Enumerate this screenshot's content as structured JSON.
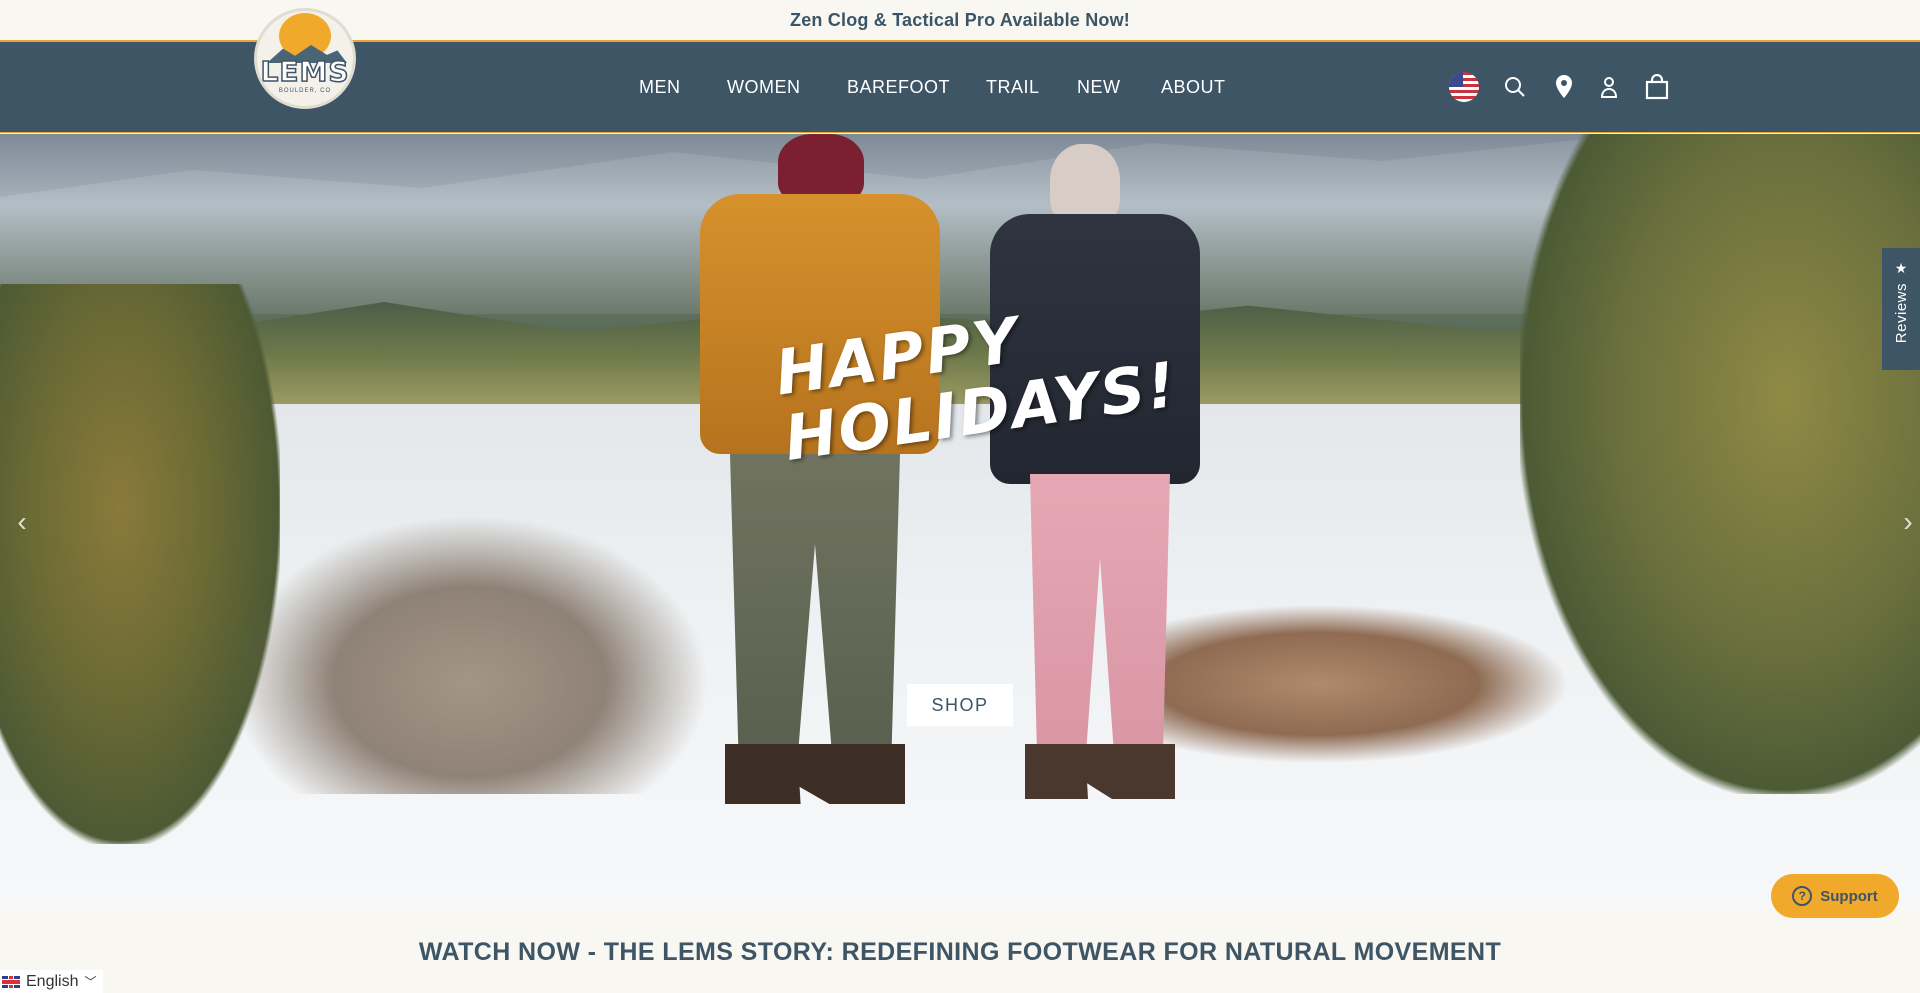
{
  "announcement": {
    "text": "Zen Clog & Tactical Pro Available Now!"
  },
  "brand": {
    "logo_text": "LEMS",
    "logo_sub": "BOULDER, CO"
  },
  "nav": {
    "items": [
      {
        "label": "MEN"
      },
      {
        "label": "WOMEN"
      },
      {
        "label": "BAREFOOT"
      },
      {
        "label": "TRAIL"
      },
      {
        "label": "NEW"
      },
      {
        "label": "ABOUT"
      }
    ]
  },
  "header_icons": {
    "flag": "us-flag-icon",
    "search": "search-icon",
    "location": "location-pin-icon",
    "account": "user-icon",
    "cart": "shopping-bag-icon"
  },
  "hero": {
    "headline": "HAPPY\nHOLIDAYS!",
    "cta_label": "SHOP",
    "prev_arrow": "‹",
    "next_arrow": "›"
  },
  "reviews_tab": {
    "star": "★",
    "label": "Reviews"
  },
  "support": {
    "icon": "?",
    "label": "Support"
  },
  "story_heading": "WATCH NOW - THE LEMS STORY: REDEFINING FOOTWEAR FOR NATURAL MOVEMENT",
  "language": {
    "label": "English",
    "chevron": "﹀"
  },
  "colors": {
    "header_bg": "#3e5566",
    "accent": "#e9a535",
    "support_bg": "#f0a92b",
    "page_bg": "#f8f7f2"
  }
}
